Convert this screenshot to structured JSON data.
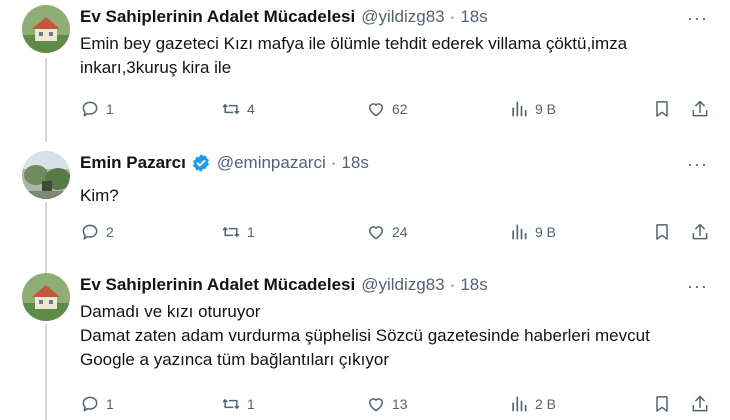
{
  "tweets": [
    {
      "author_name": "Ev Sahiplerinin Adalet Mücadelesi",
      "verified": false,
      "handle": "@yildizg83",
      "separator": "·",
      "time": "18s",
      "more": "···",
      "text_lines": [
        "Emin bey gazeteci Kızı mafya ile ölümle tehdit ederek villama çöktü,imza",
        "inkarı,3kuruş kira ile"
      ],
      "replies": "1",
      "retweets": "4",
      "likes": "62",
      "views": "9 B"
    },
    {
      "author_name": "Emin Pazarcı",
      "verified": true,
      "handle": "@eminpazarci",
      "separator": "·",
      "time": "18s",
      "more": "···",
      "text_lines": [
        "Kim?"
      ],
      "replies": "2",
      "retweets": "1",
      "likes": "24",
      "views": "9 B"
    },
    {
      "author_name": "Ev Sahiplerinin Adalet Mücadelesi",
      "verified": false,
      "handle": "@yildizg83",
      "separator": "·",
      "time": "18s",
      "more": "···",
      "text_lines": [
        "Damadı ve kızı oturuyor",
        "Damat zaten adam vurdurma şüphelisi Sözcü gazetesinde haberleri mevcut",
        "Google a yazınca tüm bağlantıları çıkıyor"
      ],
      "replies": "1",
      "retweets": "1",
      "likes": "13",
      "views": "2 B"
    }
  ],
  "colors": {
    "text": "#0f1419",
    "secondary": "#536471",
    "verified": "#1d9bf0",
    "thread_line": "#cfd9de"
  },
  "icons": [
    "reply-icon",
    "retweet-icon",
    "like-icon",
    "views-icon",
    "bookmark-icon",
    "share-icon",
    "verified-badge-icon"
  ]
}
